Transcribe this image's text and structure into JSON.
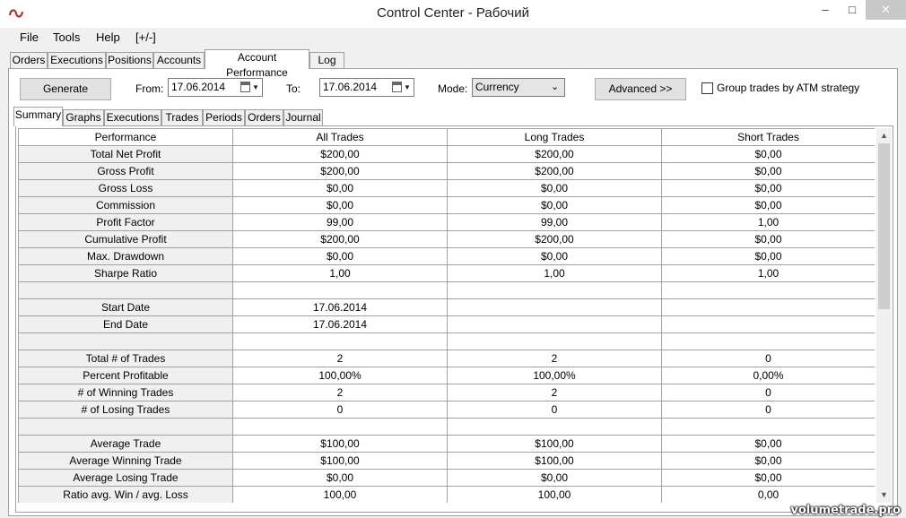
{
  "window": {
    "title": "Control Center - Рабочий",
    "controls": {
      "minimize": "–",
      "maximize": "□",
      "close": "✕"
    }
  },
  "menu": [
    "File",
    "Tools",
    "Help",
    "[+/-]"
  ],
  "main_tabs": [
    "Orders",
    "Executions",
    "Positions",
    "Accounts",
    "Account Performance",
    "Log"
  ],
  "active_main_tab": "Account Performance",
  "toolbar": {
    "generate_label": "Generate",
    "from_label": "From:",
    "from_value": "17.06.2014",
    "to_label": "To:",
    "to_value": "17.06.2014",
    "mode_label": "Mode:",
    "mode_value": "Currency",
    "advanced_label": "Advanced >>",
    "group_label": "Group trades by ATM strategy",
    "group_checked": false
  },
  "sub_tabs": [
    "Summary",
    "Graphs",
    "Executions",
    "Trades",
    "Periods",
    "Orders",
    "Journal"
  ],
  "active_sub_tab": "Summary",
  "table": {
    "headers": [
      "Performance",
      "All Trades",
      "Long Trades",
      "Short Trades"
    ],
    "rows": [
      [
        "Total Net Profit",
        "$200,00",
        "$200,00",
        "$0,00"
      ],
      [
        "Gross Profit",
        "$200,00",
        "$200,00",
        "$0,00"
      ],
      [
        "Gross Loss",
        "$0,00",
        "$0,00",
        "$0,00"
      ],
      [
        "Commission",
        "$0,00",
        "$0,00",
        "$0,00"
      ],
      [
        "Profit Factor",
        "99,00",
        "99,00",
        "1,00"
      ],
      [
        "Cumulative Profit",
        "$200,00",
        "$200,00",
        "$0,00"
      ],
      [
        "Max. Drawdown",
        "$0,00",
        "$0,00",
        "$0,00"
      ],
      [
        "Sharpe Ratio",
        "1,00",
        "1,00",
        "1,00"
      ],
      [
        "",
        "",
        "",
        ""
      ],
      [
        "Start Date",
        "17.06.2014",
        "",
        ""
      ],
      [
        "End Date",
        "17.06.2014",
        "",
        ""
      ],
      [
        "",
        "",
        "",
        ""
      ],
      [
        "Total # of Trades",
        "2",
        "2",
        "0"
      ],
      [
        "Percent Profitable",
        "100,00%",
        "100,00%",
        "0,00%"
      ],
      [
        "# of Winning Trades",
        "2",
        "2",
        "0"
      ],
      [
        "# of Losing Trades",
        "0",
        "0",
        "0"
      ],
      [
        "",
        "",
        "",
        ""
      ],
      [
        "Average Trade",
        "$100,00",
        "$100,00",
        "$0,00"
      ],
      [
        "Average Winning Trade",
        "$100,00",
        "$100,00",
        "$0,00"
      ],
      [
        "Average Losing Trade",
        "$0,00",
        "$0,00",
        "$0,00"
      ],
      [
        "Ratio avg. Win / avg. Loss",
        "100,00",
        "100,00",
        "0,00"
      ],
      [
        "",
        "",
        "",
        ""
      ]
    ]
  },
  "watermark": "volumetrade.pro"
}
